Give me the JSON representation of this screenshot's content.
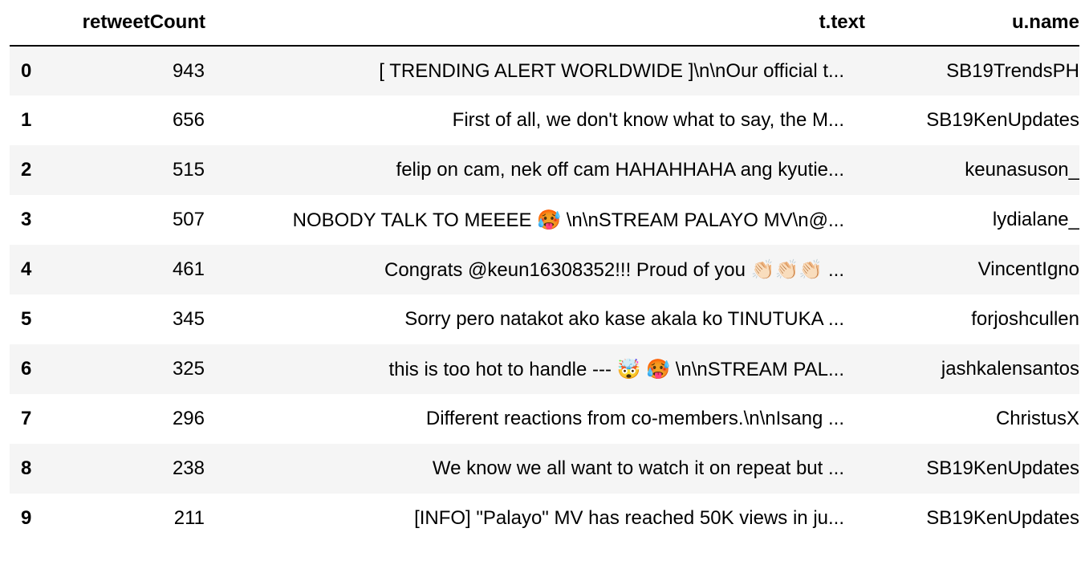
{
  "table": {
    "columns": {
      "index": "",
      "retweetCount": "retweetCount",
      "text": "t.text",
      "name": "u.name"
    },
    "rows": [
      {
        "index": "0",
        "retweetCount": "943",
        "text": "[ TRENDING ALERT WORLDWIDE ]\\n\\nOur official t...",
        "name": "SB19TrendsPH"
      },
      {
        "index": "1",
        "retweetCount": "656",
        "text": "First of all, we don't know what to say, the M...",
        "name": "SB19KenUpdates"
      },
      {
        "index": "2",
        "retweetCount": "515",
        "text": "felip on cam, nek off cam HAHAHHAHA ang kyutie...",
        "name": "keunasuson_"
      },
      {
        "index": "3",
        "retweetCount": "507",
        "text": "NOBODY TALK TO MEEEE 🥵  \\n\\nSTREAM PALAYO MV\\n@...",
        "name": "lydialane_"
      },
      {
        "index": "4",
        "retweetCount": "461",
        "text": "Congrats @keun16308352!!! Proud of you 👏🏻👏🏻👏🏻 ...",
        "name": "VincentIgno"
      },
      {
        "index": "5",
        "retweetCount": "345",
        "text": "Sorry pero natakot ako kase akala ko TINUTUKA ...",
        "name": "forjoshcullen"
      },
      {
        "index": "6",
        "retweetCount": "325",
        "text": "this is too hot to handle --- 🤯 🥵 \\n\\nSTREAM PAL...",
        "name": "jashkalensantos"
      },
      {
        "index": "7",
        "retweetCount": "296",
        "text": "Different reactions from co-members.\\n\\nIsang ...",
        "name": "ChristusX"
      },
      {
        "index": "8",
        "retweetCount": "238",
        "text": "We know we all want to watch it on repeat but ...",
        "name": "SB19KenUpdates"
      },
      {
        "index": "9",
        "retweetCount": "211",
        "text": "[INFO] \"Palayo\" MV has reached 50K views in ju...",
        "name": "SB19KenUpdates"
      }
    ]
  }
}
